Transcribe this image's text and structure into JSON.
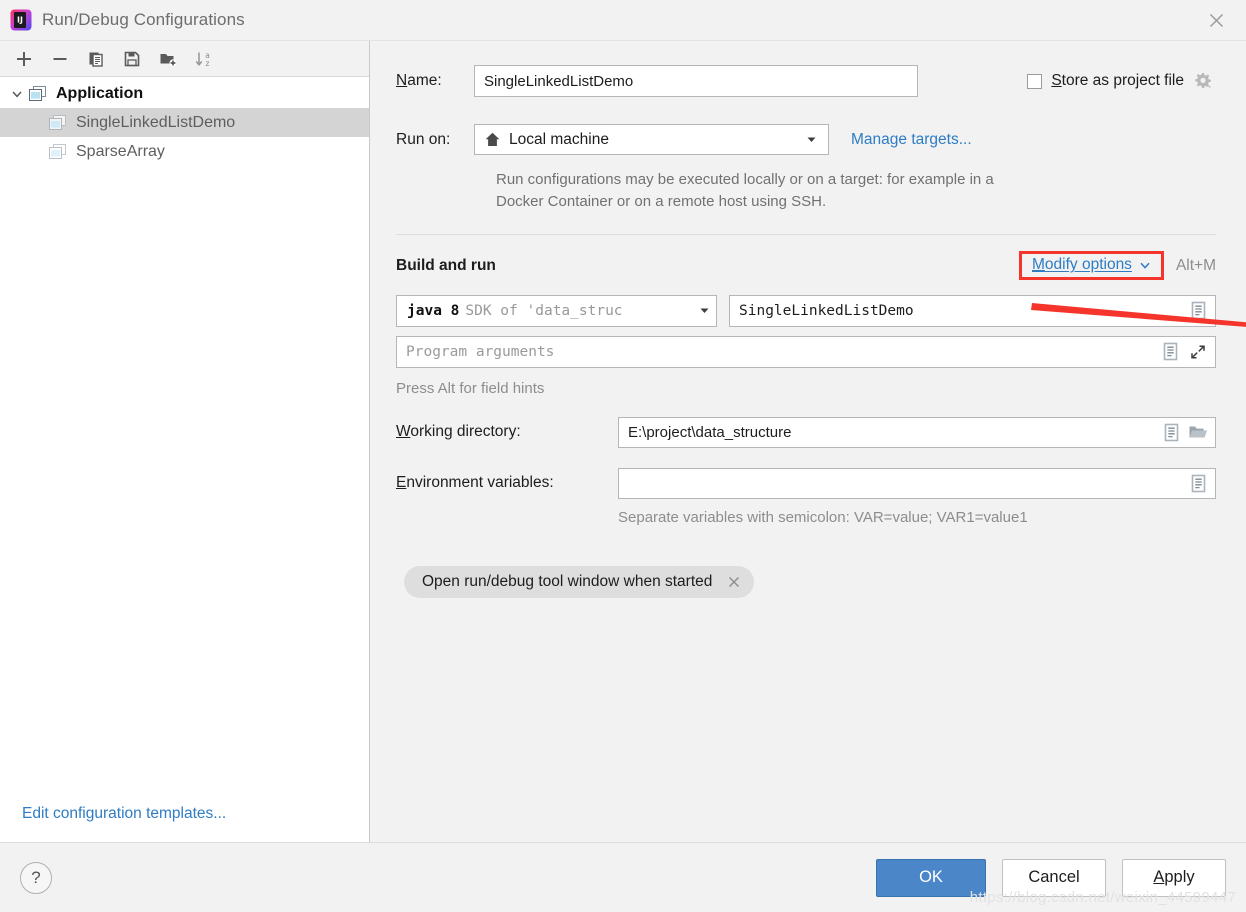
{
  "window": {
    "title": "Run/Debug Configurations",
    "app_icon": "intellij-idea-logo",
    "close_icon": "close-icon"
  },
  "left_panel": {
    "toolbar": [
      {
        "name": "add-configuration-button",
        "icon": "plus-icon",
        "tooltip": "Add New Configuration"
      },
      {
        "name": "remove-configuration-button",
        "icon": "minus-icon",
        "tooltip": "Remove Configuration"
      },
      {
        "name": "copy-configuration-button",
        "icon": "copy-icon",
        "tooltip": "Copy Configuration"
      },
      {
        "name": "save-configuration-button",
        "icon": "save-floppy-icon",
        "tooltip": "Save Configuration"
      },
      {
        "name": "move-into-folder-button",
        "icon": "folder-add-icon",
        "tooltip": "Move into new folder / Create new folder"
      },
      {
        "name": "sort-configurations-button",
        "icon": "sort-alphabetically-icon",
        "tooltip": "Sort Configurations"
      }
    ],
    "tree": [
      {
        "label": "Application",
        "icon": "application-group-icon",
        "depth": 0,
        "expanded": true,
        "bold": true,
        "selected": false
      },
      {
        "label": "SingleLinkedListDemo",
        "icon": "application-config-icon",
        "depth": 1,
        "expanded": null,
        "bold": false,
        "selected": true
      },
      {
        "label": "SparseArray",
        "icon": "application-config-icon",
        "depth": 1,
        "expanded": null,
        "bold": false,
        "selected": false
      }
    ],
    "edit_templates_link": "Edit configuration templates..."
  },
  "main": {
    "name": {
      "label": "Name:",
      "mnemonic": "N",
      "value": "SingleLinkedListDemo"
    },
    "store_as_project_file": {
      "label": "Store as project file",
      "mnemonic": "S",
      "checked": false,
      "gear_icon": "gear-dropdown-icon"
    },
    "run_on": {
      "label": "Run on:",
      "value": "Local machine",
      "value_icon": "home-icon",
      "dropdown_icon": "chevron-down-icon",
      "manage_targets_link": "Manage targets...",
      "description": "Run configurations may be executed locally or on a target: for example in a Docker Container or on a remote host using SSH."
    },
    "build_and_run": {
      "title": "Build and run",
      "modify_options_link": "Modify options",
      "modify_options_mnemonic": "M",
      "modify_options_chevron": "chevron-down-icon",
      "shortcut": "Alt+M",
      "highlight_color": "#f5352b",
      "annotation_arrow": "red-arrow-pointing-right"
    },
    "sdk": {
      "main_text": "java 8",
      "rest_text": "SDK of 'data_struc",
      "dropdown_icon": "triangle-down-icon"
    },
    "main_class": {
      "value": "SingleLinkedListDemo",
      "macro_icon": "expand-macro-icon"
    },
    "program_arguments": {
      "placeholder": "Program arguments",
      "value": "",
      "macro_icon": "expand-macro-icon",
      "expand_icon": "expand-editor-icon"
    },
    "field_hints": "Press Alt for field hints",
    "working_directory": {
      "label": "Working directory:",
      "mnemonic": "W",
      "value": "E:\\project\\data_structure",
      "macro_icon": "expand-macro-icon",
      "browse_icon": "folder-open-icon"
    },
    "environment_variables": {
      "label": "Environment variables:",
      "mnemonic": "E",
      "value": "",
      "macro_icon": "expand-macro-icon",
      "hint": "Separate variables with semicolon: VAR=value; VAR1=value1"
    },
    "option_chip": {
      "label": "Open run/debug tool window when started",
      "close_icon": "close-icon"
    }
  },
  "footer": {
    "help_icon": "question-mark-icon",
    "ok_label": "OK",
    "cancel_label": "Cancel",
    "apply_label": "Apply",
    "apply_mnemonic": "A",
    "primary_color": "#4a86c8"
  },
  "watermark": "https://blog.csdn.net/weixin_44599447"
}
